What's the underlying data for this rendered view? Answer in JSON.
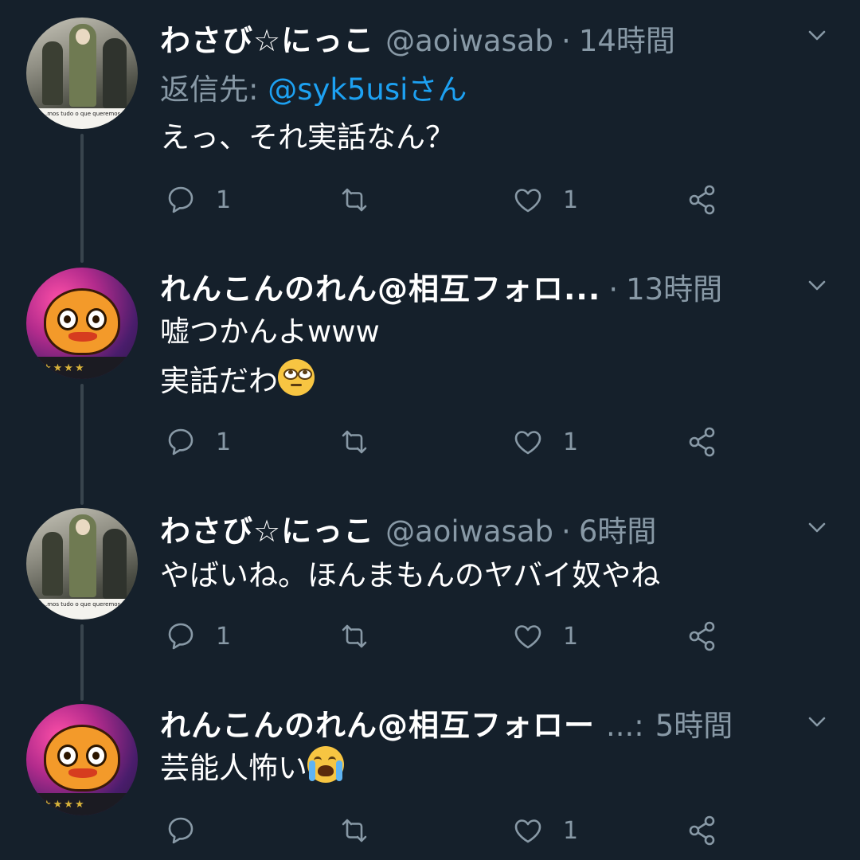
{
  "theme": {
    "background": "#15202b",
    "text": "#ffffff",
    "muted": "#8899a6",
    "link": "#1da1f2",
    "thread_line": "#38444d"
  },
  "tweets": [
    {
      "display_name": "わさび☆にっこ",
      "handle": "@aoiwasab",
      "separator": "·",
      "time": "14時間",
      "reply_prefix": "返信先: ",
      "reply_mention": "@syk5usiさん",
      "lines": [
        "えっ、それ実話なん？"
      ],
      "reply_count": "1",
      "like_count": "1",
      "avatar": "anime-characters-avatar",
      "avatar_caption": "...mos tudo o que queremos."
    },
    {
      "display_name": "れんこんのれん@相互フォロ...",
      "separator": "·",
      "time": "13時間",
      "lines": [
        "嘘つかんよwww",
        "実話だわ"
      ],
      "emoji": "face-with-rolling-eyes",
      "reply_count": "1",
      "like_count": "1",
      "avatar": "chick-character-avatar"
    },
    {
      "display_name": "わさび☆にっこ",
      "handle": "@aoiwasab",
      "separator": "·",
      "time": "6時間",
      "lines": [
        "やばいね。ほんまもんのヤバイ奴やね"
      ],
      "reply_count": "1",
      "like_count": "1",
      "avatar": "anime-characters-avatar",
      "avatar_caption": "...mos tudo o que queremos."
    },
    {
      "display_name": "れんこんのれん@相互フォロー",
      "handle_truncated": "...:",
      "time": "5時間",
      "lines": [
        "芸能人怖い"
      ],
      "emoji": "loudly-crying-face",
      "reply_count": "",
      "like_count": "1",
      "avatar": "chick-character-avatar"
    }
  ],
  "icons": {
    "reply": "reply-bubble-icon",
    "retweet": "retweet-icon",
    "like": "heart-icon",
    "share": "share-icon",
    "menu": "chevron-down-icon"
  }
}
